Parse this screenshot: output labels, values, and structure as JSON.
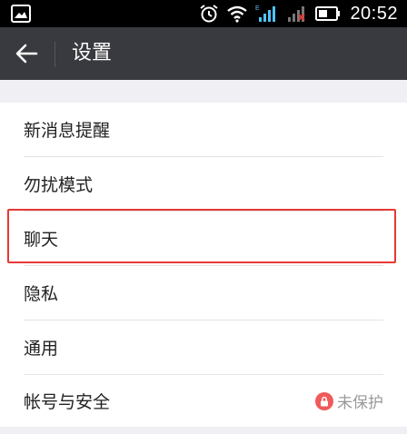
{
  "status_bar": {
    "time": "20:52",
    "icons": [
      "image-icon",
      "alarm-icon",
      "wifi-icon",
      "signal-icon",
      "signal-icon-2",
      "battery-icon"
    ]
  },
  "header": {
    "title": "设置",
    "back_icon": "back-arrow-icon"
  },
  "settings": {
    "items": [
      {
        "label": "新消息提醒"
      },
      {
        "label": "勿扰模式"
      },
      {
        "label": "聊天"
      },
      {
        "label": "隐私"
      },
      {
        "label": "通用"
      },
      {
        "label": "帐号与安全",
        "status": "未保护",
        "status_icon": "lock-icon"
      }
    ]
  },
  "colors": {
    "status_bar_bg": "#000000",
    "title_bar_bg": "#393a3f",
    "page_bg": "#efeff4",
    "highlight_border": "#e53935",
    "lock_badge": "#f05a5a"
  }
}
